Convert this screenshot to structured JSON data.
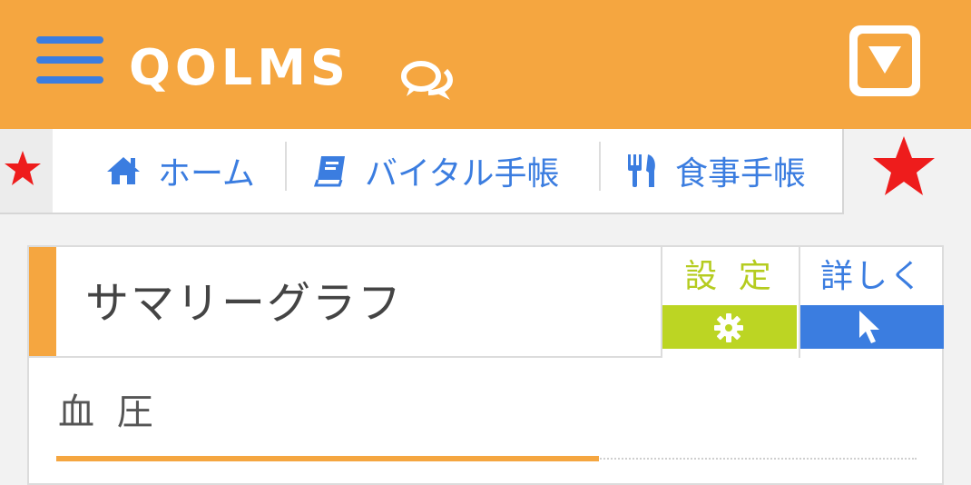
{
  "header": {
    "logo": "QOLMS",
    "icons": {
      "menu": "hamburger-menu-icon",
      "chat": "chat-bubbles-icon",
      "dropdown": "dropdown-square-icon"
    }
  },
  "nav": {
    "items": [
      {
        "label": "ホーム",
        "icon": "home-icon"
      },
      {
        "label": "バイタル手帳",
        "icon": "notebook-icon"
      },
      {
        "label": "食事手帳",
        "icon": "fork-knife-icon"
      }
    ]
  },
  "panel": {
    "title": "サマリーグラフ",
    "settings_label": "設 定",
    "detail_label": "詳しく",
    "section_title": "血 圧"
  },
  "colors": {
    "brand_orange": "#f5a640",
    "link_blue": "#3b7de0",
    "settings_green": "#bcd523",
    "star_red": "#ee1c1c"
  }
}
